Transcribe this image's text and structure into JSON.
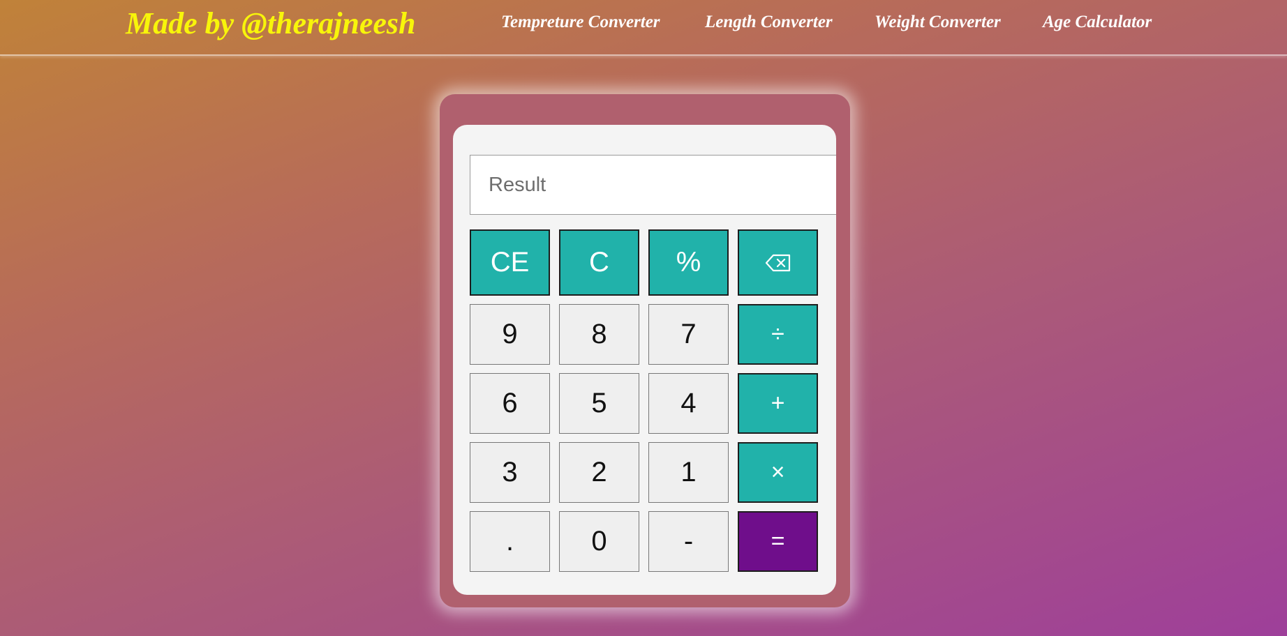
{
  "header": {
    "brand": "Made by @therajneesh",
    "links": [
      {
        "label": "Tempreture Converter"
      },
      {
        "label": "Length Converter"
      },
      {
        "label": "Weight Converter"
      },
      {
        "label": "Age Calculator"
      }
    ]
  },
  "calculator": {
    "result": {
      "placeholder": "Result",
      "value": ""
    },
    "keys": {
      "ce": "CE",
      "c": "C",
      "percent": "%",
      "backspace_icon": "backspace-icon",
      "nine": "9",
      "eight": "8",
      "seven": "7",
      "divide": "÷",
      "six": "6",
      "five": "5",
      "four": "4",
      "plus": "+",
      "three": "3",
      "two": "2",
      "one": "1",
      "multiply": "×",
      "dot": ".",
      "zero": "0",
      "minus": "-",
      "equals": "="
    }
  },
  "colors": {
    "brand_text": "#f8f50a",
    "operator_key": "#21b2aa",
    "equals_key": "#6f0e8b",
    "number_key": "#efefef"
  }
}
